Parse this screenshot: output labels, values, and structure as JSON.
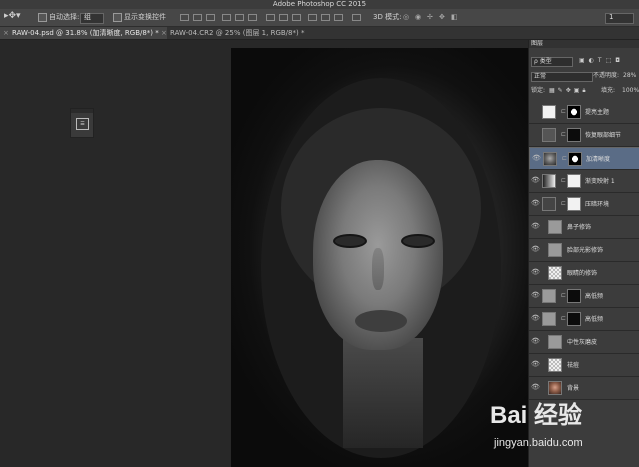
{
  "app": {
    "title": "Adobe Photoshop CC 2015"
  },
  "options_bar": {
    "auto_select_label": "自动选择:",
    "auto_select_value": "组",
    "show_transform_label": "显示变换控件",
    "mode_3d_label": "3D 模式:",
    "workspace_value": "1"
  },
  "tabs": [
    {
      "label": "RAW-04.psd @ 31.8% (加清晰度, RGB/8*) *",
      "active": true
    },
    {
      "label": "RAW-04.CR2 @ 25% (图层 1, RGB/8*) *",
      "active": false
    }
  ],
  "layers_panel": {
    "tab_label": "图层",
    "filter_value": "ρ 类型",
    "blend_mode": "正常",
    "opacity_label": "不透明度:",
    "opacity_value": "28%",
    "lock_label": "锁定:",
    "fill_label": "填充:",
    "fill_value": "100%",
    "layers": [
      {
        "name": "提亮主题",
        "visible": false,
        "mask": "white-shape",
        "selected": false
      },
      {
        "name": "恢复眼部细节",
        "visible": false,
        "mask": "black",
        "selected": false
      },
      {
        "name": "加清晰度",
        "visible": true,
        "mask": "blackwhite",
        "selected": true
      },
      {
        "name": "渐变映射 1",
        "visible": true,
        "mask": "white",
        "selected": false
      },
      {
        "name": "压暗环境",
        "visible": true,
        "mask": "white",
        "selected": false
      },
      {
        "name": "鼻子修饰",
        "visible": true,
        "mask": "none",
        "selected": false
      },
      {
        "name": "脸部光影修饰",
        "visible": true,
        "mask": "none",
        "selected": false
      },
      {
        "name": "眼睛的修饰",
        "visible": true,
        "mask": "none",
        "selected": false
      },
      {
        "name": "高低频",
        "visible": true,
        "mask": "black",
        "selected": false
      },
      {
        "name": "高低频",
        "visible": true,
        "mask": "black",
        "selected": false
      },
      {
        "name": "中性灰磨皮",
        "visible": true,
        "mask": "none",
        "selected": false
      },
      {
        "name": "祛痘",
        "visible": true,
        "mask": "none",
        "selected": false
      },
      {
        "name": "背景",
        "visible": true,
        "mask": "none",
        "selected": false
      }
    ]
  },
  "watermark": {
    "logo_text": "Bai 经验",
    "url_text": "jingyan.baidu.com"
  }
}
